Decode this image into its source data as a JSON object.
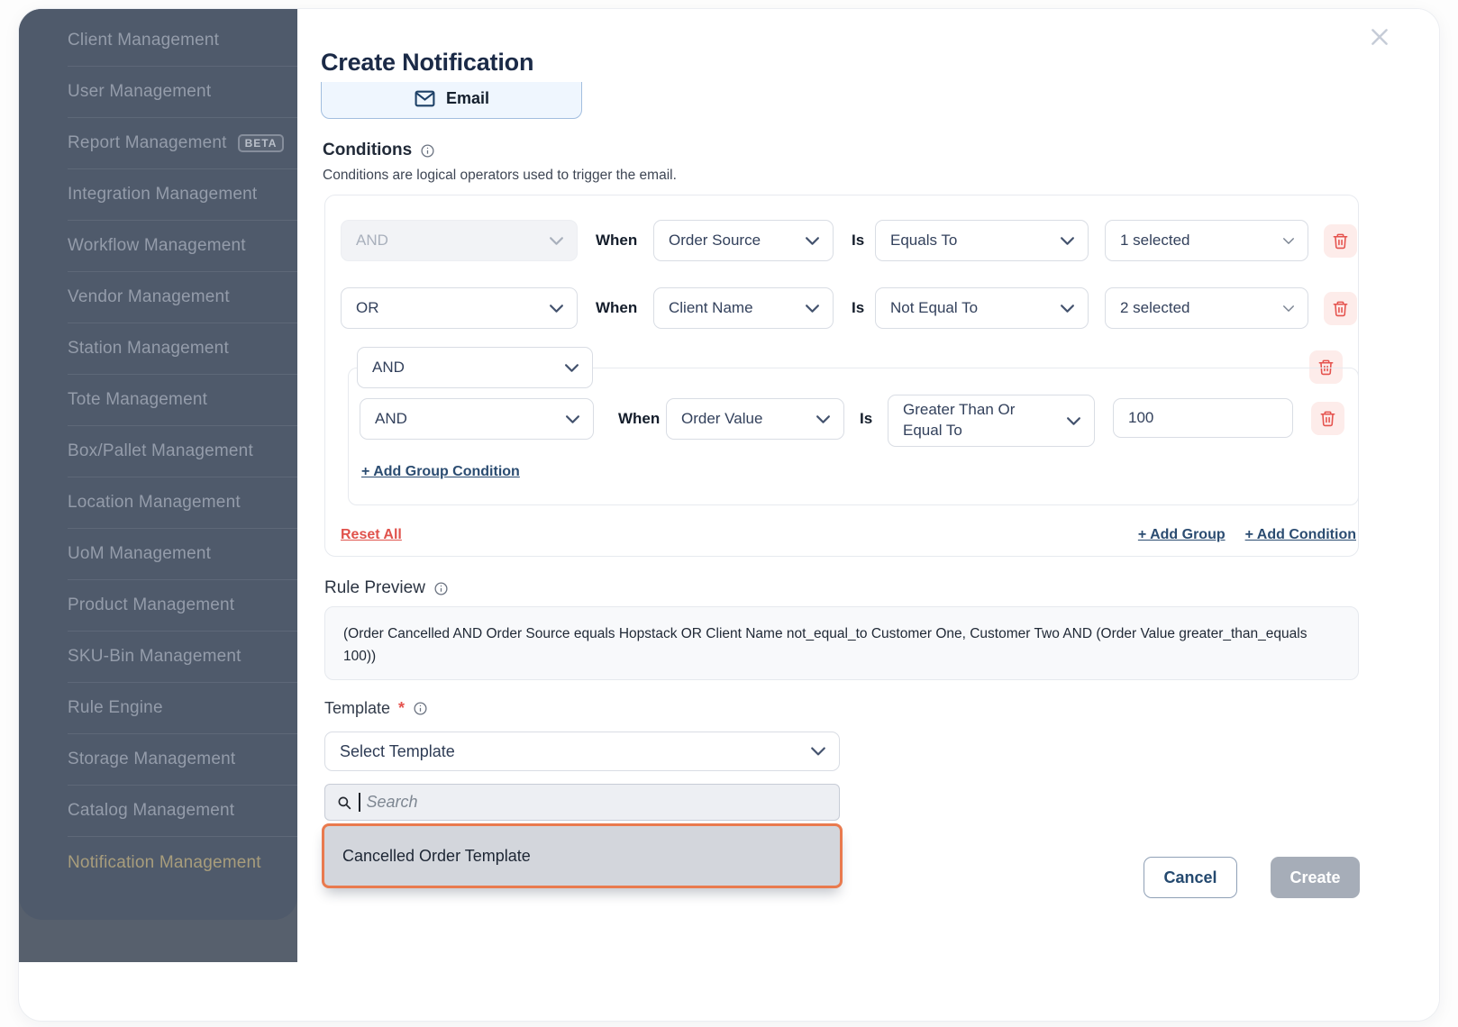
{
  "sidebar": {
    "items": [
      {
        "label": "Client Management"
      },
      {
        "label": "User Management"
      },
      {
        "label": "Report Management",
        "badge": "BETA"
      },
      {
        "label": "Integration Management"
      },
      {
        "label": "Workflow Management"
      },
      {
        "label": "Vendor Management"
      },
      {
        "label": "Station Management"
      },
      {
        "label": "Tote Management"
      },
      {
        "label": "Box/Pallet Management"
      },
      {
        "label": "Location Management"
      },
      {
        "label": "UoM Management"
      },
      {
        "label": "Product Management"
      },
      {
        "label": "SKU-Bin Management"
      },
      {
        "label": "Rule Engine"
      },
      {
        "label": "Storage Management"
      },
      {
        "label": "Catalog Management"
      },
      {
        "label": "Notification Management"
      }
    ]
  },
  "modal": {
    "title": "Create Notification",
    "channel": {
      "label": "Email",
      "icon": "envelope-icon"
    },
    "conditions": {
      "label": "Conditions",
      "description": "Conditions are logical operators used to trigger the email.",
      "rows": [
        {
          "operator": "AND",
          "when": "When",
          "field": "Order Source",
          "is": "Is",
          "comparator": "Equals To",
          "value": "1 selected"
        },
        {
          "operator": "OR",
          "when": "When",
          "field": "Client Name",
          "is": "Is",
          "comparator": "Not Equal To",
          "value": "2 selected"
        }
      ],
      "group": {
        "operator": "AND",
        "row": {
          "operator": "AND",
          "when": "When",
          "field": "Order Value",
          "is": "Is",
          "comparator": "Greater Than Or Equal To",
          "value": "100"
        },
        "add_group_condition": "+ Add Group Condition"
      },
      "reset_all": "Reset All",
      "add_group": "+ Add Group",
      "add_condition": "+ Add Condition"
    },
    "rule_preview": {
      "label": "Rule Preview",
      "text": "(Order Cancelled AND Order Source equals Hopstack OR Client Name not_equal_to Customer One, Customer Two AND (Order Value greater_than_equals 100))"
    },
    "template": {
      "label": "Template",
      "required_marker": "*",
      "selected_value": "Select Template",
      "search_placeholder": "Search",
      "options": [
        "Cancelled Order Template"
      ]
    },
    "footer": {
      "cancel": "Cancel",
      "create": "Create"
    }
  },
  "colors": {
    "accent_orange": "#E97A4E",
    "danger_red": "#E5534E",
    "link_navy": "#2B4C71",
    "sidebar_bg": "#4F5A6B",
    "sidebar_active_gold": "#A89D7C",
    "email_chip_bg": "#EFF6FE",
    "disabled_button_bg": "#A6ADB8"
  }
}
